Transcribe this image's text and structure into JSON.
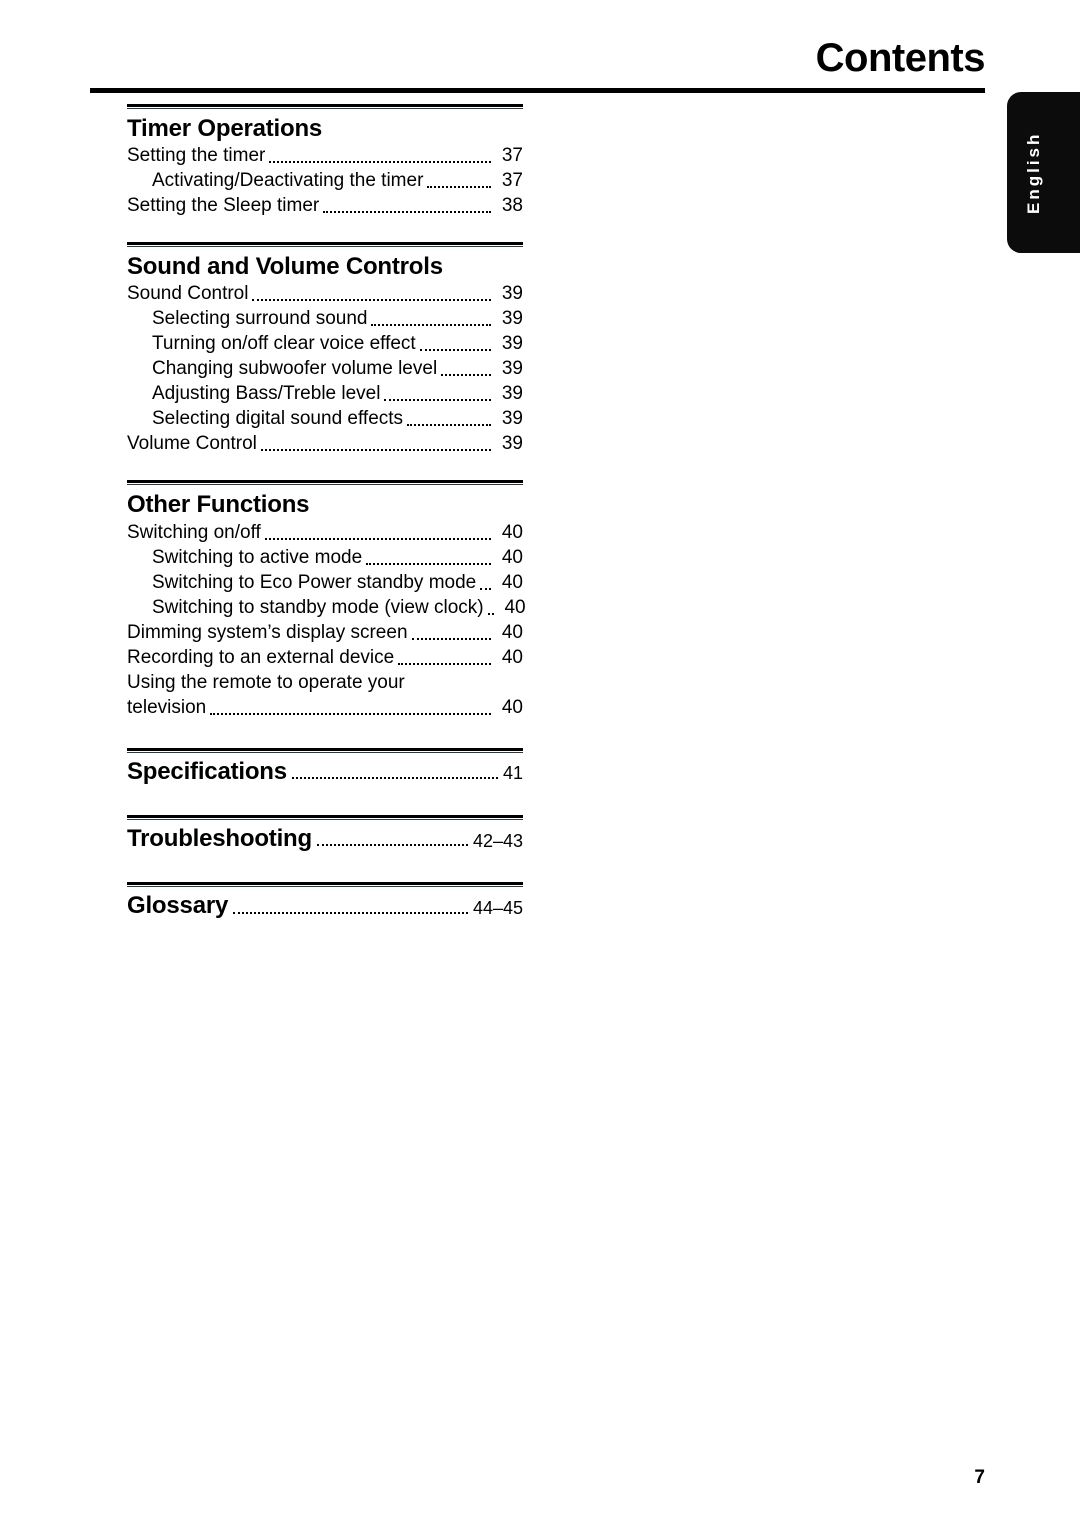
{
  "header": {
    "title": "Contents"
  },
  "language_tab": {
    "label": "English",
    "background": "#0c0c0c",
    "text_color": "#ffffff"
  },
  "footer": {
    "page_number": "7"
  },
  "toc": {
    "sections": [
      {
        "title": "Timer Operations",
        "entries": [
          {
            "text": "Setting the timer",
            "page": "37",
            "level": 0,
            "leader": true
          },
          {
            "text": "Activating/Deactivating the timer",
            "page": "37",
            "level": 1,
            "leader": true
          },
          {
            "text": "Setting the Sleep timer",
            "page": "38",
            "level": 0,
            "leader": true
          }
        ]
      },
      {
        "title": "Sound and Volume Controls",
        "entries": [
          {
            "text": "Sound Control",
            "page": "39",
            "level": 0,
            "leader": true
          },
          {
            "text": "Selecting surround sound",
            "page": "39",
            "level": 1,
            "leader": true
          },
          {
            "text": "Turning on/off clear voice effect",
            "page": "39",
            "level": 1,
            "leader": true
          },
          {
            "text": "Changing subwoofer volume level",
            "page": "39",
            "level": 1,
            "leader": true
          },
          {
            "text": "Adjusting Bass/Treble level",
            "page": "39",
            "level": 1,
            "leader": true
          },
          {
            "text": "Selecting digital sound effects",
            "page": "39",
            "level": 1,
            "leader": true
          },
          {
            "text": "Volume Control",
            "page": "39",
            "level": 0,
            "leader": true
          }
        ]
      },
      {
        "title": "Other Functions",
        "entries": [
          {
            "text": "Switching on/off",
            "page": "40",
            "level": 0,
            "leader": true
          },
          {
            "text": "Switching to active mode",
            "page": "40",
            "level": 1,
            "leader": true
          },
          {
            "text": "Switching to Eco Power standby mode",
            "page": "40",
            "level": 1,
            "leader": true
          },
          {
            "text": "Switching to standby mode (view clock)",
            "page": "40",
            "level": 1,
            "leader": true
          },
          {
            "text": "Dimming system’s display screen",
            "page": "40",
            "level": 0,
            "leader": true
          },
          {
            "text": "Recording to an external device",
            "page": "40",
            "level": 0,
            "leader": true
          },
          {
            "text": "Using the remote to operate your",
            "page": "",
            "level": 0,
            "leader": false
          },
          {
            "text": "television",
            "page": "40",
            "level": 0,
            "leader": true
          }
        ]
      }
    ],
    "big_sections": [
      {
        "title": "Specifications",
        "page": "41"
      },
      {
        "title": "Troubleshooting",
        "page": "42–43"
      },
      {
        "title": "Glossary",
        "page": "44–45"
      }
    ]
  }
}
